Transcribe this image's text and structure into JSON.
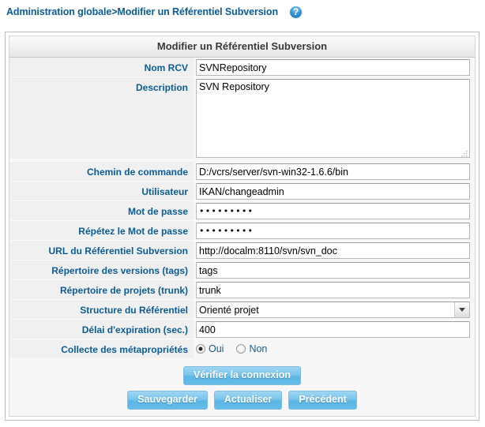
{
  "breadcrumb": {
    "text": "Administration globale>Modifier un Référentiel Subversion",
    "help_icon": "help-question-icon",
    "help_glyph": "?"
  },
  "form": {
    "title": "Modifier un Référentiel Subversion",
    "fields": [
      {
        "label": "Nom RCV",
        "value": "SVNRepository",
        "type": "text"
      },
      {
        "label": "Description",
        "value": "SVN Repository",
        "type": "textarea"
      },
      {
        "label": "Chemin de commande",
        "value": "D:/vcrs/server/svn-win32-1.6.6/bin",
        "type": "text"
      },
      {
        "label": "Utilisateur",
        "value": "IKAN/changeadmin",
        "type": "text"
      },
      {
        "label": "Mot de passe",
        "value": "•••••••••",
        "type": "password"
      },
      {
        "label": "Répétez le Mot de passe",
        "value": "•••••••••",
        "type": "password"
      },
      {
        "label": "URL du Référentiel Subversion",
        "value": "http://docalm:8110/svn/svn_doc",
        "type": "text"
      },
      {
        "label": "Répertoire des versions (tags)",
        "value": "tags",
        "type": "text"
      },
      {
        "label": "Répertoire de projets (trunk)",
        "value": "trunk",
        "type": "text"
      },
      {
        "label": "Structure du Référentiel",
        "value": "Orienté projet",
        "type": "select"
      },
      {
        "label": "Délai d'expiration (sec.)",
        "value": "400",
        "type": "text"
      },
      {
        "label": "Collecte des métapropriétés",
        "value": "Oui",
        "type": "radio"
      }
    ],
    "radio_options": [
      {
        "label": "Oui",
        "selected": true
      },
      {
        "label": "Non",
        "selected": false
      }
    ]
  },
  "buttons": {
    "verify": "Vérifier la connexion",
    "save": "Sauvegarder",
    "refresh": "Actualiser",
    "back": "Précédent"
  },
  "colors": {
    "label_blue": "#0b5c96",
    "button_blue": "#5cb6e6",
    "panel_bg": "#f7f7f7",
    "label_cell_bg": "#f0f0f0"
  }
}
